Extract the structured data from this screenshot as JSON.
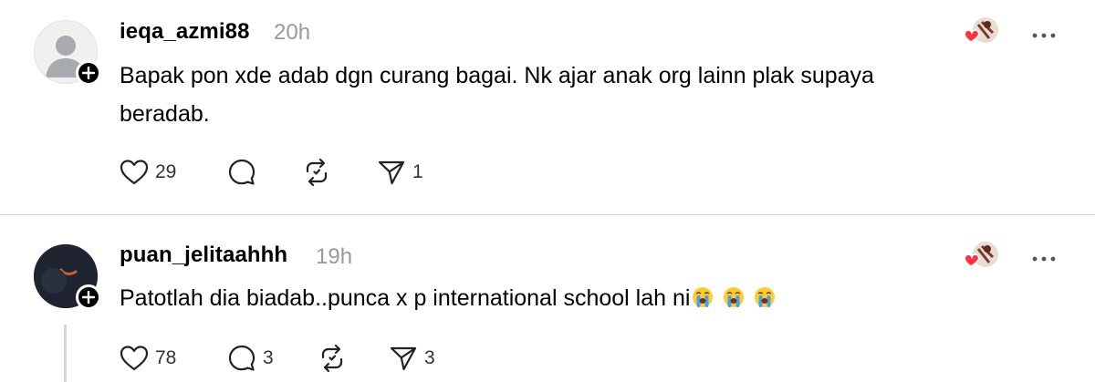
{
  "posts": [
    {
      "username": "ieqa_azmi88",
      "time": "20h",
      "text": "Bapak pon xde adab dgn curang bagai. Nk ajar anak org lainn plak supaya beradab.",
      "likes": "29",
      "replies": "",
      "reposts": "",
      "shares": "1",
      "avatar_icon": "default-person-icon"
    },
    {
      "username": "puan_jelitaahhh",
      "time": "19h",
      "text": "Patotlah dia biadab..punca x p international school lah ni",
      "emojis": [
        "loudly-crying-face",
        "loudly-crying-face",
        "loudly-crying-face"
      ],
      "likes": "78",
      "replies": "3",
      "reposts": "",
      "shares": "3",
      "avatar_icon": "dark-moon-avatar"
    }
  ],
  "colors": {
    "heart_red": "#ff3040",
    "muted_text": "#999999",
    "divider": "#d9d9d9"
  }
}
